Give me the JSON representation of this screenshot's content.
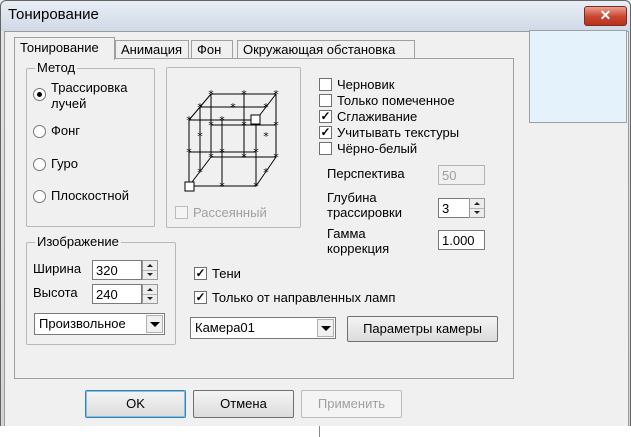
{
  "window": {
    "title": "Тонирование",
    "close_label": "✕"
  },
  "tabs": [
    {
      "label": "Тонирование",
      "active": true
    },
    {
      "label": "Анимация",
      "active": false
    },
    {
      "label": "Фон",
      "active": false
    },
    {
      "label": "Окружающая обстановка",
      "active": false
    }
  ],
  "method": {
    "group_label": "Метод",
    "options": [
      {
        "label": "Трассировка лучей",
        "line1": "Трассировка",
        "line2": "лучей",
        "selected": true
      },
      {
        "label": "Фонг",
        "selected": false
      },
      {
        "label": "Гуро",
        "selected": false
      },
      {
        "label": "Плоскостной",
        "selected": false
      }
    ]
  },
  "preview_area": {
    "diffuse_label": "Рассеянный",
    "diffuse_checked": false,
    "diffuse_enabled": false
  },
  "options": [
    {
      "label": "Черновик",
      "checked": false
    },
    {
      "label": "Только помеченное",
      "checked": false
    },
    {
      "label": "Сглаживание",
      "checked": true
    },
    {
      "label": "Учитывать текстуры",
      "checked": true
    },
    {
      "label": "Чёрно-белый",
      "checked": false
    }
  ],
  "perspective": {
    "label": "Перспектива",
    "value": "50",
    "enabled": false
  },
  "trace_depth": {
    "label_line1": "Глубина",
    "label_line2": "трассировки",
    "value": "3"
  },
  "gamma": {
    "label_line1": "Гамма",
    "label_line2": "коррекция",
    "value": "1.000"
  },
  "image": {
    "group_label": "Изображение",
    "width_label": "Ширина",
    "width_value": "320",
    "height_label": "Высота",
    "height_value": "240",
    "size_preset": "Произвольное"
  },
  "shadows": {
    "label": "Тени",
    "checked": true
  },
  "directional_only": {
    "label": "Только от направленных ламп",
    "checked": true
  },
  "camera": {
    "selected": "Камера01",
    "params_button": "Параметры камеры"
  },
  "footer": {
    "ok": "OK",
    "cancel": "Отмена",
    "apply": "Применить"
  },
  "checkmark": "✓"
}
